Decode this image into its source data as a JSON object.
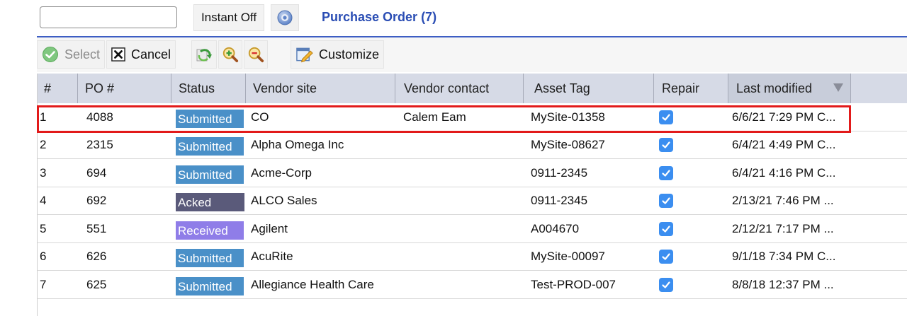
{
  "topbar": {
    "search_value": "",
    "instant_label": "Instant Off",
    "title": "Purchase Order (7)"
  },
  "toolbar": {
    "select_label": "Select",
    "cancel_label": "Cancel",
    "customize_label": "Customize"
  },
  "grid": {
    "headers": [
      "#",
      "PO #",
      "Status",
      "Vendor site",
      "Vendor contact",
      "Asset Tag",
      "Repair",
      "Last modified"
    ],
    "sorted_column": "Last modified",
    "rows": [
      {
        "num": "1",
        "po": "4088",
        "status": "Submitted",
        "vendor_site": "CO",
        "vendor_contact": "Calem Eam",
        "asset_tag": "MySite-01358",
        "repair": true,
        "last_modified": "6/6/21 7:29 PM C..."
      },
      {
        "num": "2",
        "po": "2315",
        "status": "Submitted",
        "vendor_site": "Alpha Omega Inc",
        "vendor_contact": "",
        "asset_tag": "MySite-08627",
        "repair": true,
        "last_modified": "6/4/21 4:49 PM C..."
      },
      {
        "num": "3",
        "po": "694",
        "status": "Submitted",
        "vendor_site": "Acme-Corp",
        "vendor_contact": "",
        "asset_tag": "0911-2345",
        "repair": true,
        "last_modified": "6/4/21 4:16 PM C..."
      },
      {
        "num": "4",
        "po": "692",
        "status": "Acked",
        "vendor_site": "ALCO Sales",
        "vendor_contact": "",
        "asset_tag": "0911-2345",
        "repair": true,
        "last_modified": "2/13/21 7:46 PM ..."
      },
      {
        "num": "5",
        "po": "551",
        "status": "Received",
        "vendor_site": "Agilent",
        "vendor_contact": "",
        "asset_tag": "A004670",
        "repair": true,
        "last_modified": "2/12/21 7:17 PM ..."
      },
      {
        "num": "6",
        "po": "626",
        "status": "Submitted",
        "vendor_site": "AcuRite",
        "vendor_contact": "",
        "asset_tag": "MySite-00097",
        "repair": true,
        "last_modified": "9/1/18 7:34 PM C..."
      },
      {
        "num": "7",
        "po": "625",
        "status": "Submitted",
        "vendor_site": "Allegiance Health Care",
        "vendor_contact": "",
        "asset_tag": "Test-PROD-007",
        "repair": true,
        "last_modified": "8/8/18 12:37 PM ..."
      }
    ]
  },
  "colors": {
    "title_blue": "#2a4db4",
    "status_submitted": "#4a90c8",
    "status_acked": "#5a5a7a",
    "status_received": "#8f7de8",
    "checkbox_blue": "#3b8ef0",
    "highlight_red": "#e21a1a"
  }
}
